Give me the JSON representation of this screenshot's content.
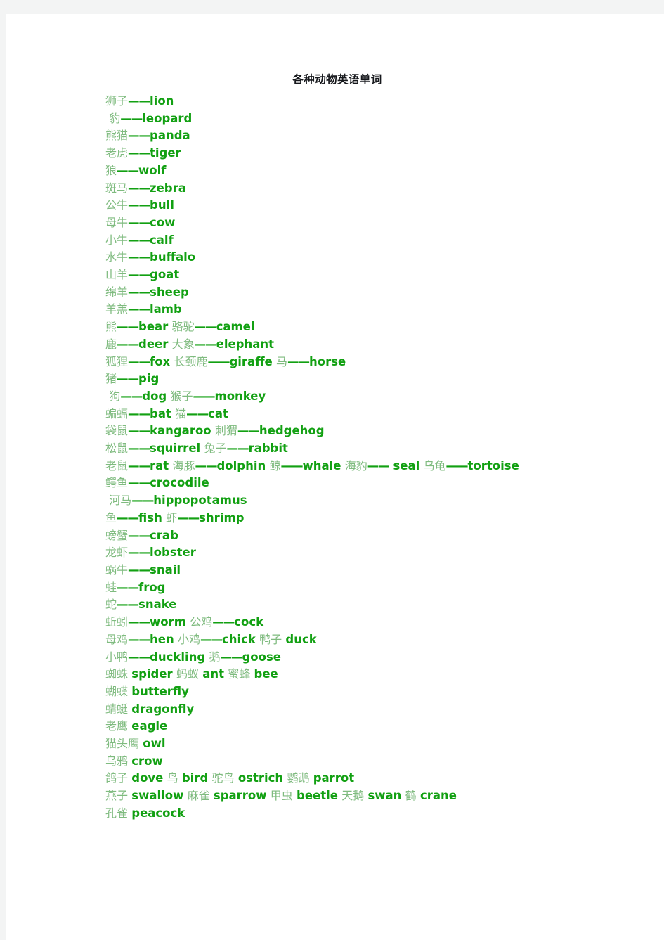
{
  "document": {
    "title": "各种动物英语单词",
    "separator": "——",
    "colors": {
      "page_background": "#ffffff",
      "canvas_background": "#f3f4f4",
      "title_text": "#16181c",
      "chinese_text": "#7fbb7f",
      "english_text": "#12a012"
    },
    "lines": [
      {
        "indent": false,
        "segments": [
          {
            "cn": "狮子",
            "dash": true,
            "en": "lion"
          }
        ]
      },
      {
        "indent": true,
        "segments": [
          {
            "cn": "豹",
            "dash": true,
            "en": "leopard"
          }
        ]
      },
      {
        "indent": false,
        "segments": [
          {
            "cn": "熊猫",
            "dash": true,
            "en": "panda"
          }
        ]
      },
      {
        "indent": false,
        "segments": [
          {
            "cn": "老虎",
            "dash": true,
            "en": "tiger"
          }
        ]
      },
      {
        "indent": false,
        "segments": [
          {
            "cn": "狼",
            "dash": true,
            "en": "wolf"
          }
        ]
      },
      {
        "indent": false,
        "segments": [
          {
            "cn": "斑马",
            "dash": true,
            "en": "zebra"
          }
        ]
      },
      {
        "indent": false,
        "segments": [
          {
            "cn": "公牛",
            "dash": true,
            "en": "bull"
          }
        ]
      },
      {
        "indent": false,
        "segments": [
          {
            "cn": "母牛",
            "dash": true,
            "en": "cow"
          }
        ]
      },
      {
        "indent": false,
        "segments": [
          {
            "cn": "小牛",
            "dash": true,
            "en": "calf"
          }
        ]
      },
      {
        "indent": false,
        "segments": [
          {
            "cn": "水牛",
            "dash": true,
            "en": "buffalo"
          }
        ]
      },
      {
        "indent": false,
        "segments": [
          {
            "cn": "山羊",
            "dash": true,
            "en": "goat"
          }
        ]
      },
      {
        "indent": false,
        "segments": [
          {
            "cn": "绵羊",
            "dash": true,
            "en": "sheep"
          }
        ]
      },
      {
        "indent": false,
        "segments": [
          {
            "cn": "羊羔",
            "dash": true,
            "en": "lamb"
          }
        ]
      },
      {
        "indent": false,
        "segments": [
          {
            "cn": "熊",
            "dash": true,
            "en": "bear"
          },
          {
            "cn": "骆驼",
            "dash": true,
            "en": "camel"
          }
        ]
      },
      {
        "indent": false,
        "segments": [
          {
            "cn": "鹿",
            "dash": true,
            "en": "deer"
          },
          {
            "cn": "大象",
            "dash": true,
            "en": "elephant"
          }
        ]
      },
      {
        "indent": false,
        "segments": [
          {
            "cn": "狐狸",
            "dash": true,
            "en": "fox"
          },
          {
            "cn": "长颈鹿",
            "dash": true,
            "en": "giraffe"
          },
          {
            "cn": "马",
            "dash": true,
            "en": "horse"
          }
        ]
      },
      {
        "indent": false,
        "segments": [
          {
            "cn": "猪",
            "dash": true,
            "en": "pig"
          }
        ]
      },
      {
        "indent": true,
        "segments": [
          {
            "cn": "狗",
            "dash": true,
            "en": "dog"
          },
          {
            "cn": "猴子",
            "dash": true,
            "en": "monkey"
          }
        ]
      },
      {
        "indent": false,
        "segments": [
          {
            "cn": "蝙蝠",
            "dash": true,
            "en": "bat"
          },
          {
            "cn": "猫",
            "dash": true,
            "en": "cat"
          }
        ]
      },
      {
        "indent": false,
        "segments": [
          {
            "cn": "袋鼠",
            "dash": true,
            "en": "kangaroo"
          },
          {
            "cn": "刺猬",
            "dash": true,
            "en": "hedgehog"
          }
        ]
      },
      {
        "indent": false,
        "segments": [
          {
            "cn": "松鼠",
            "dash": true,
            "en": "squirrel"
          },
          {
            "cn": "兔子",
            "dash": true,
            "en": "rabbit"
          }
        ]
      },
      {
        "indent": false,
        "segments": [
          {
            "cn": "老鼠",
            "dash": true,
            "en": "rat"
          },
          {
            "cn": "海豚",
            "dash": true,
            "en": "dolphin"
          },
          {
            "cn": "鲸",
            "dash": true,
            "en": "whale"
          },
          {
            "cn": "海豹",
            "dash": true,
            "en": " seal"
          },
          {
            "cn": "乌龟",
            "dash": true,
            "en": "tortoise"
          }
        ]
      },
      {
        "indent": false,
        "segments": [
          {
            "cn": "鳄鱼",
            "dash": true,
            "en": "crocodile"
          }
        ]
      },
      {
        "indent": true,
        "segments": [
          {
            "cn": "河马",
            "dash": true,
            "en": "hippopotamus"
          }
        ]
      },
      {
        "indent": false,
        "segments": [
          {
            "cn": "鱼",
            "dash": true,
            "en": "fish"
          },
          {
            "cn": "虾",
            "dash": true,
            "en": "shrimp"
          }
        ]
      },
      {
        "indent": false,
        "segments": [
          {
            "cn": "螃蟹",
            "dash": true,
            "en": "crab"
          }
        ]
      },
      {
        "indent": false,
        "segments": [
          {
            "cn": "龙虾",
            "dash": true,
            "en": "lobster"
          }
        ]
      },
      {
        "indent": false,
        "segments": [
          {
            "cn": "蜗牛",
            "dash": true,
            "en": "snail"
          }
        ]
      },
      {
        "indent": false,
        "segments": [
          {
            "cn": "蛙",
            "dash": true,
            "en": "frog"
          }
        ]
      },
      {
        "indent": false,
        "segments": [
          {
            "cn": "蛇",
            "dash": true,
            "en": "snake"
          }
        ]
      },
      {
        "indent": false,
        "segments": [
          {
            "cn": "蚯蚓",
            "dash": true,
            "en": "worm"
          },
          {
            "cn": "公鸡",
            "dash": true,
            "en": "cock"
          }
        ]
      },
      {
        "indent": false,
        "segments": [
          {
            "cn": "母鸡",
            "dash": true,
            "en": "hen"
          },
          {
            "cn": "小鸡",
            "dash": true,
            "en": "chick"
          },
          {
            "cn": "鸭子",
            "dash": false,
            "en": "duck"
          }
        ]
      },
      {
        "indent": false,
        "segments": [
          {
            "cn": "小鸭",
            "dash": true,
            "en": "duckling"
          },
          {
            "cn": "鹅",
            "dash": true,
            "en": "goose"
          }
        ]
      },
      {
        "indent": false,
        "segments": [
          {
            "cn": "蜘蛛",
            "dash": false,
            "en": "spider"
          },
          {
            "cn": "蚂蚁",
            "dash": false,
            "en": "ant"
          },
          {
            "cn": "蜜蜂",
            "dash": false,
            "en": "bee"
          }
        ]
      },
      {
        "indent": false,
        "segments": [
          {
            "cn": "蝴蝶",
            "dash": false,
            "en": "butterfly"
          }
        ]
      },
      {
        "indent": false,
        "segments": [
          {
            "cn": "蜻蜓",
            "dash": false,
            "en": "dragonfly"
          }
        ]
      },
      {
        "indent": false,
        "segments": [
          {
            "cn": "老鹰",
            "dash": false,
            "en": "eagle"
          }
        ]
      },
      {
        "indent": false,
        "segments": [
          {
            "cn": "猫头鹰",
            "dash": false,
            "en": "owl"
          }
        ]
      },
      {
        "indent": false,
        "segments": [
          {
            "cn": "乌鸦",
            "dash": false,
            "en": "crow"
          }
        ]
      },
      {
        "indent": false,
        "segments": [
          {
            "cn": "鸽子",
            "dash": false,
            "en": "dove"
          },
          {
            "cn": "鸟",
            "dash": false,
            "en": "bird"
          },
          {
            "cn": "驼鸟",
            "dash": false,
            "en": "ostrich"
          },
          {
            "cn": "鹦鹉",
            "dash": false,
            "en": "parrot"
          }
        ]
      },
      {
        "indent": false,
        "segments": [
          {
            "cn": "燕子",
            "dash": false,
            "en": "swallow"
          },
          {
            "cn": "麻雀",
            "dash": false,
            "en": "sparrow"
          },
          {
            "cn": "甲虫",
            "dash": false,
            "en": "beetle"
          },
          {
            "cn": "天鹅",
            "dash": false,
            "en": "swan"
          },
          {
            "cn": "鹤",
            "dash": false,
            "en": "crane"
          }
        ]
      },
      {
        "indent": false,
        "segments": [
          {
            "cn": "孔雀",
            "dash": false,
            "en": "peacock"
          }
        ]
      }
    ]
  }
}
